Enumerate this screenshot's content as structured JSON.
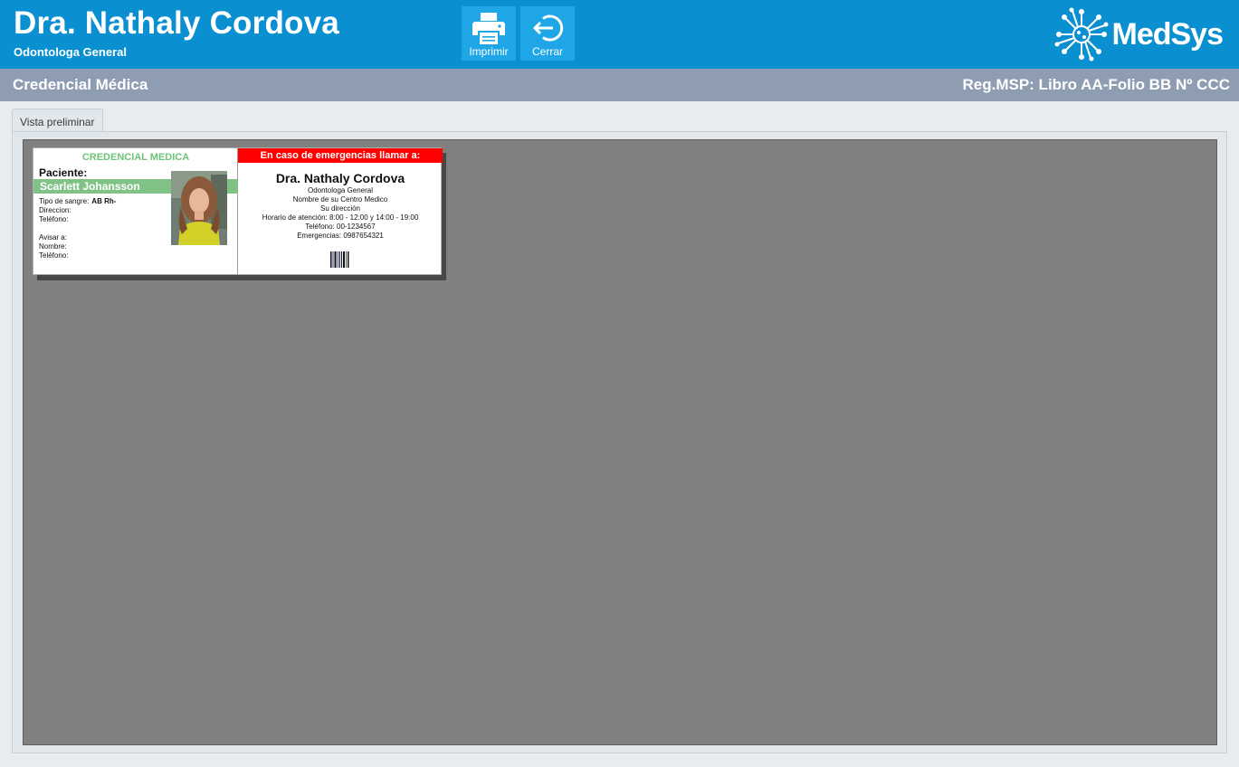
{
  "header": {
    "doctor_name": "Dra. Nathaly Cordova",
    "specialty": "Odontologa General",
    "print_label": "Imprimir",
    "close_label": "Cerrar",
    "brand": "MedSys",
    "color": "#0a8fd1"
  },
  "subbar": {
    "title": "Credencial Médica",
    "registration": "Reg.MSP: Libro AA-Folio BB Nº CCC"
  },
  "tab": {
    "label": "Vista preliminar"
  },
  "card": {
    "left": {
      "title": "CREDENCIAL MEDICA",
      "patient_label": "Paciente:",
      "patient_name": "Scarlett Johansson",
      "blood_label": "Tipo de sangre:",
      "blood_value": "AB Rh-",
      "address_label": "Direccion:",
      "phone_label": "Teléfono:",
      "notify_label": "Avisar a:",
      "name_label": "Nombre:",
      "notify_phone_label": "Teléfono:"
    },
    "right": {
      "emergency_header": "En caso de emergencias llamar a:",
      "doctor_name": "Dra. Nathaly Cordova",
      "specialty": "Odontologa General",
      "center": "Nombre de su Centro Medico",
      "address": "Su dirección",
      "hours": "Horario de atención: 8:00 - 12:00 y 14:00 - 19:00",
      "phone": "Teléfono: 00-1234567",
      "emergency_phone": "Emergencias: 0987654321"
    }
  }
}
